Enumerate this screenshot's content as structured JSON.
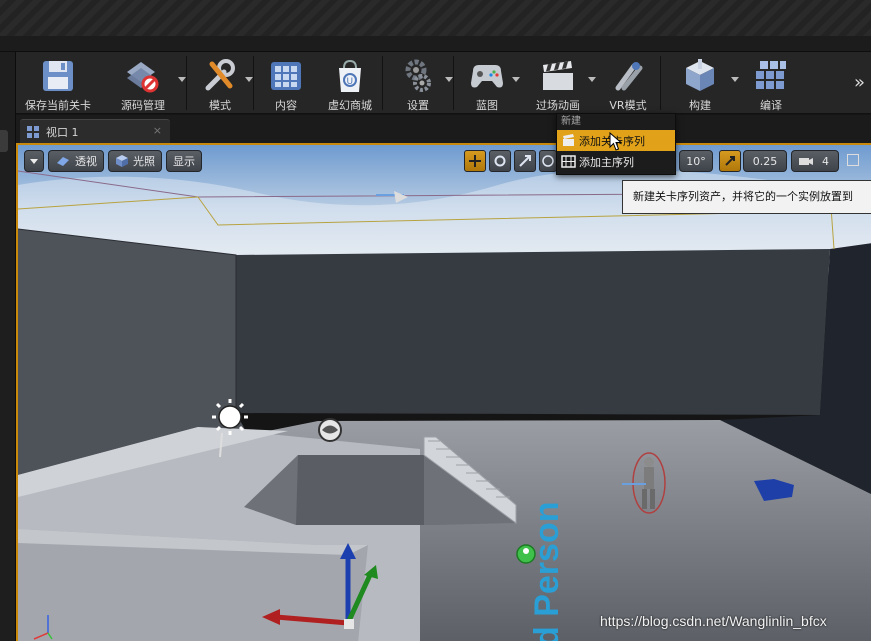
{
  "toolbar": {
    "items": [
      {
        "label": "保存当前关卡",
        "icon": "save-icon"
      },
      {
        "label": "源码管理",
        "icon": "source-control-icon"
      },
      {
        "label": "模式",
        "icon": "modes-icon"
      },
      {
        "label": "内容",
        "icon": "content-icon"
      },
      {
        "label": "虚幻商城",
        "icon": "marketplace-icon"
      },
      {
        "label": "设置",
        "icon": "settings-icon"
      },
      {
        "label": "蓝图",
        "icon": "blueprint-icon"
      },
      {
        "label": "过场动画",
        "icon": "cinematics-icon"
      },
      {
        "label": "VR模式",
        "icon": "vr-mode-icon"
      },
      {
        "label": "构建",
        "icon": "build-icon"
      },
      {
        "label": "编译",
        "icon": "compile-icon"
      }
    ],
    "more": "»"
  },
  "tab": {
    "label": "视口 1",
    "close": "×"
  },
  "viewport": {
    "perspective": "透视",
    "lit": "光照",
    "show": "显示",
    "angle_snap": "10°",
    "scale_snap": "0.25",
    "camera_speed": "4"
  },
  "menu": {
    "header": "新建",
    "items": [
      {
        "label": "添加关卡序列"
      },
      {
        "label": "添加主序列"
      }
    ]
  },
  "tooltip": {
    "text": "新建关卡序列资产，并将它的一个实例放置到"
  },
  "scene_text": {
    "floor_text": "d Person"
  },
  "watermark": "https://blog.csdn.net/Wanglinlin_bfcx",
  "colors": {
    "accent": "#c98a0c",
    "menu_highlight": "#e1a21a"
  }
}
